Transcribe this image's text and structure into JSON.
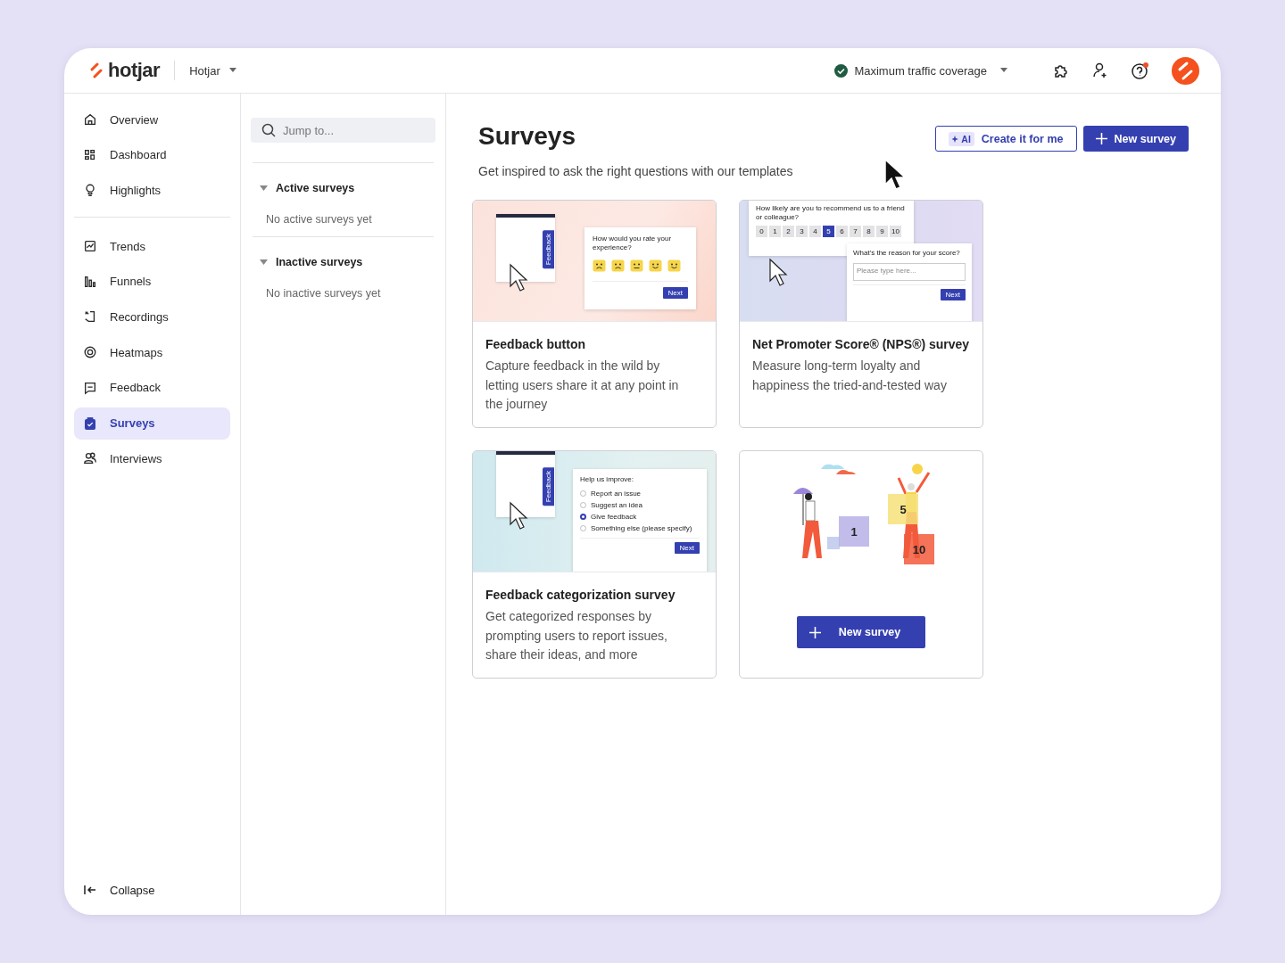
{
  "header": {
    "logo": "hotjar",
    "site": "Hotjar",
    "coverage": "Maximum traffic coverage"
  },
  "nav": [
    [
      {
        "label": "Overview",
        "kind": "home",
        "selected": false
      },
      {
        "label": "Dashboard",
        "kind": "grid",
        "selected": false
      },
      {
        "label": "Highlights",
        "kind": "bulb",
        "selected": false
      }
    ],
    [
      {
        "label": "Trends",
        "kind": "chart",
        "selected": false
      },
      {
        "label": "Funnels",
        "kind": "bars",
        "selected": false
      },
      {
        "label": "Recordings",
        "kind": "recording",
        "selected": false
      },
      {
        "label": "Heatmaps",
        "kind": "target",
        "selected": false
      },
      {
        "label": "Feedback",
        "kind": "message",
        "selected": false
      },
      {
        "label": "Surveys",
        "kind": "clipboard",
        "selected": true
      },
      {
        "label": "Interviews",
        "kind": "people",
        "selected": false
      }
    ]
  ],
  "collapse": "Collapse",
  "panel": {
    "search": {
      "placeholder": "Jump to..."
    },
    "sections": [
      {
        "title": "Active surveys",
        "expanded": true,
        "empty": "No active surveys yet"
      },
      {
        "title": "Inactive surveys",
        "expanded": true,
        "empty": "No inactive surveys yet"
      }
    ]
  },
  "main": {
    "title": "Surveys",
    "subtitle": "Get inspired to ask the right questions with our templates",
    "ai_badge": "AI",
    "create_button": "Create it for me",
    "new_button": "New survey"
  },
  "templates": [
    {
      "kind": "rating",
      "title": "Feedback button",
      "description": "Capture feedback in the wild by letting users share it at any point in the journey",
      "tab": "Feedback",
      "question": "How would you rate your experience?",
      "next": "Next"
    },
    {
      "kind": "nps",
      "title": "Net Promoter Score® (NPS®) survey",
      "description": "Measure long-term loyalty and happiness the tried-and-tested way",
      "question": "How likely are you to recommend us to a friend or colleague?",
      "scale": [
        {
          "label": "0",
          "selected": false
        },
        {
          "label": "1",
          "selected": false
        },
        {
          "label": "2",
          "selected": false
        },
        {
          "label": "3",
          "selected": false
        },
        {
          "label": "4",
          "selected": false
        },
        {
          "label": "5",
          "selected": true
        },
        {
          "label": "6",
          "selected": false
        },
        {
          "label": "7",
          "selected": false
        },
        {
          "label": "8",
          "selected": false
        },
        {
          "label": "9",
          "selected": false
        },
        {
          "label": "10",
          "selected": false
        }
      ],
      "followup": "What's the reason for your score?",
      "placeholder": "Please type here...",
      "next": "Next"
    },
    {
      "kind": "category",
      "title": "Feedback categorization survey",
      "description": "Get categorized responses by prompting users to report issues, share their ideas, and more",
      "tab": "Feedback",
      "question": "Help us improve:",
      "options": [
        {
          "label": "Report an issue",
          "selected": false
        },
        {
          "label": "Suggest an idea",
          "selected": false
        },
        {
          "label": "Give feedback",
          "selected": true
        },
        {
          "label": "Something else (please specify)",
          "selected": false
        }
      ],
      "next": "Next"
    },
    {
      "kind": "illustration",
      "tiles": [
        "1",
        "5",
        "10"
      ],
      "button": "New survey"
    }
  ]
}
